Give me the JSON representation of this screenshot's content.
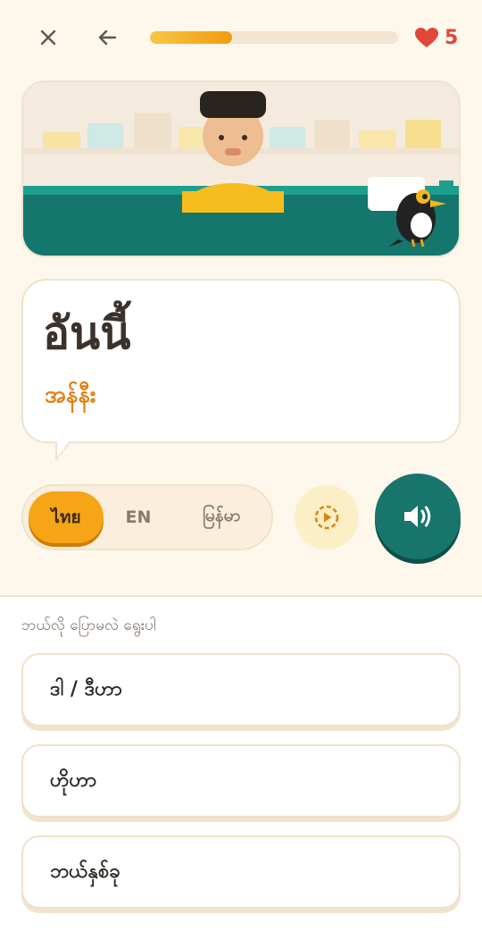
{
  "header": {
    "close_icon": "close-icon",
    "back_icon": "arrow-left-icon",
    "progress": 0.33,
    "hearts": "5",
    "heart_color": "#e0463a",
    "progress_color": "#f19c0e"
  },
  "card": {
    "word": "อันนี้",
    "transliteration": "အန်နီး"
  },
  "languages": {
    "options": [
      "ไทย",
      "EN",
      "မြန်မာ"
    ],
    "selected": "ไทย"
  },
  "controls": {
    "slow_icon": "slow-play-icon",
    "audio_icon": "speaker-icon"
  },
  "question": {
    "prompt": "ဘယ်လို ပြောမလဲ ရွေးပါ",
    "choices": [
      "ဒါ / ဒီဟာ",
      "ဟိုဟာ",
      "ဘယ်နှစ်ခု"
    ]
  },
  "colors": {
    "accent_orange": "#f6a516",
    "teal": "#17756c",
    "background": "#fdf7ec"
  }
}
